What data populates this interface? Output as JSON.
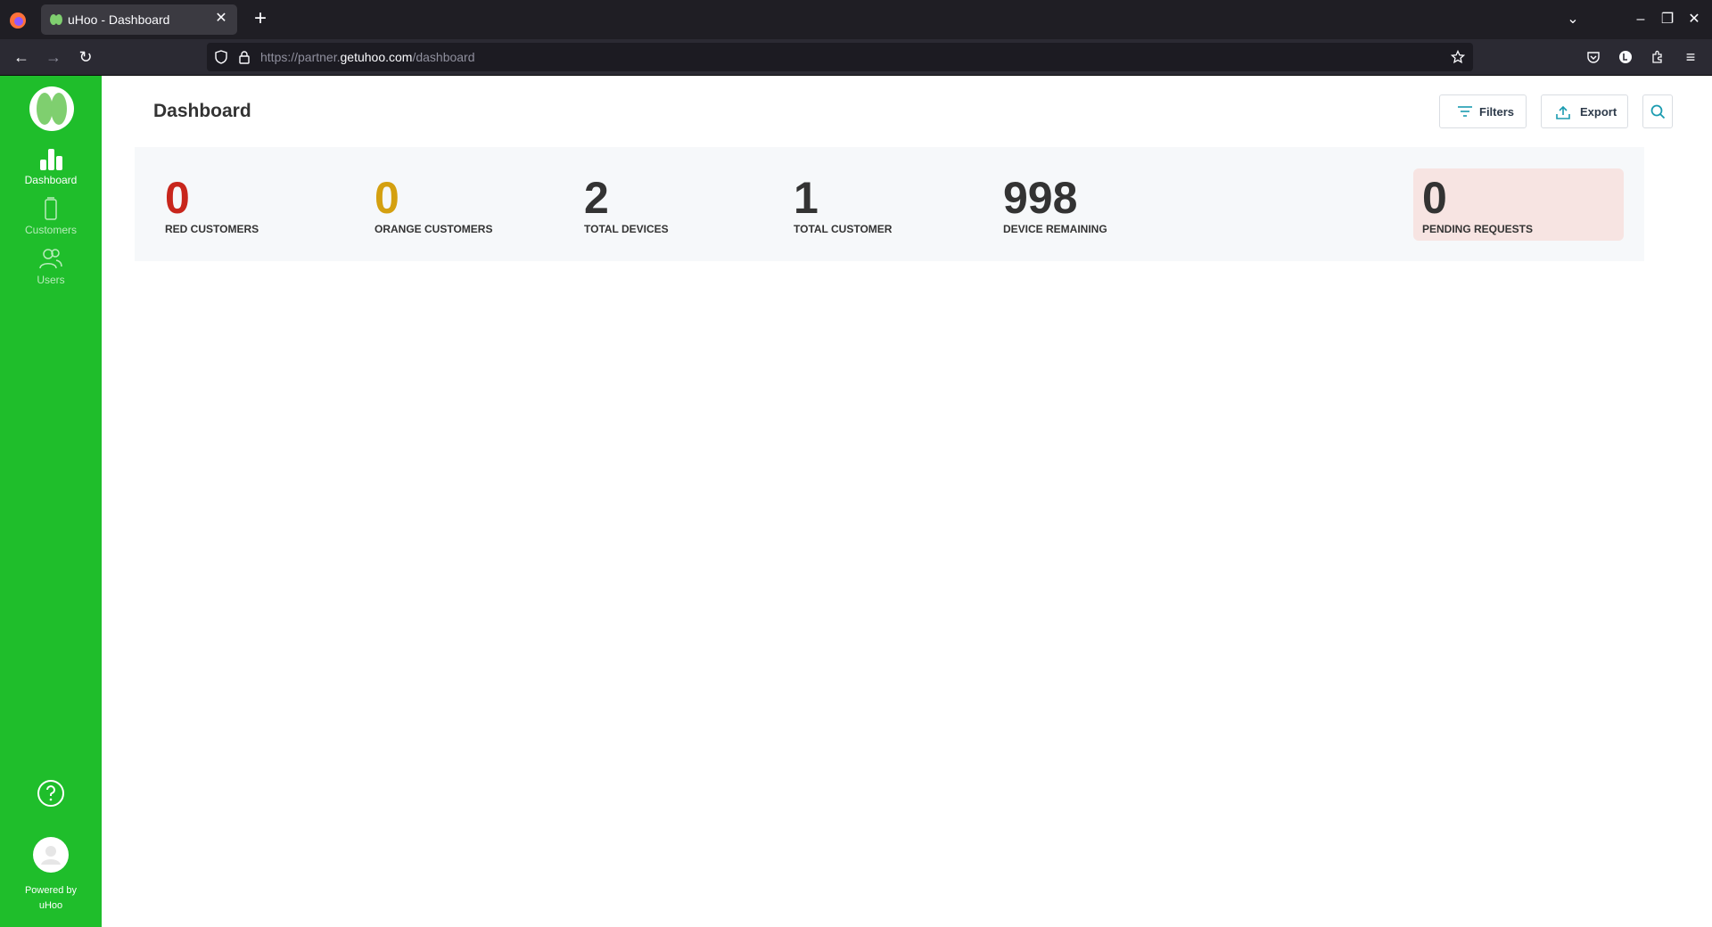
{
  "browser": {
    "tab_title": "uHoo - Dashboard",
    "url_prefix": "https://partner.",
    "url_host": "getuhoo.com",
    "url_path": "/dashboard"
  },
  "sidebar": {
    "items": [
      {
        "label": "Dashboard",
        "active": true
      },
      {
        "label": "Customers",
        "active": false
      },
      {
        "label": "Users",
        "active": false
      }
    ],
    "powered_by_line1": "Powered by",
    "powered_by_line2": "uHoo"
  },
  "header": {
    "title": "Dashboard",
    "filters_label": "Filters",
    "export_label": "Export"
  },
  "stats": [
    {
      "value": "0",
      "label": "RED CUSTOMERS",
      "color": "#c8261c"
    },
    {
      "value": "0",
      "label": "ORANGE CUSTOMERS",
      "color": "#d4a010"
    },
    {
      "value": "2",
      "label": "TOTAL DEVICES",
      "color": "#333333"
    },
    {
      "value": "1",
      "label": "TOTAL CUSTOMER",
      "color": "#333333"
    },
    {
      "value": "998",
      "label": "DEVICE REMAINING",
      "color": "#333333"
    },
    {
      "value": "0",
      "label": "PENDING REQUESTS",
      "color": "#333333"
    }
  ],
  "colors": {
    "sidebar": "#1fbe2b",
    "accent_teal": "#1a9bb0",
    "pending_bg": "#f7e4e2"
  }
}
